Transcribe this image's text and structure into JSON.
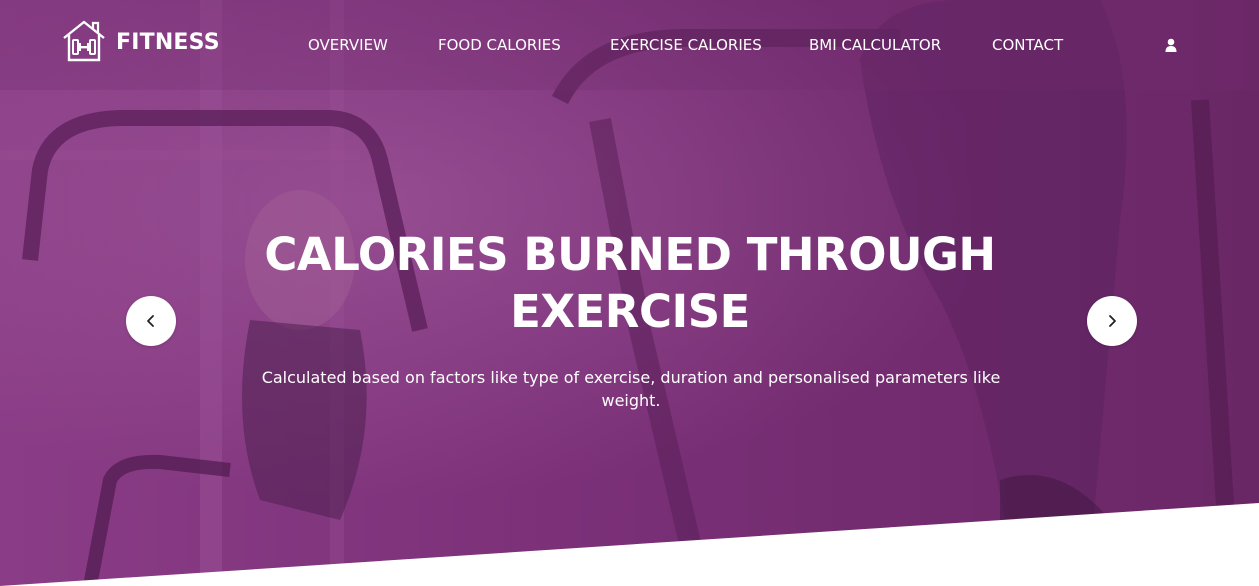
{
  "brand": {
    "name": "FITNESS",
    "logo_icon": "house-dumbbell-icon"
  },
  "nav": {
    "items": [
      {
        "label": "OVERVIEW"
      },
      {
        "label": "FOOD CALORIES"
      },
      {
        "label": "EXERCISE CALORIES"
      },
      {
        "label": "BMI CALCULATOR"
      },
      {
        "label": "CONTACT"
      }
    ],
    "account_icon": "user-icon"
  },
  "hero": {
    "title": "CALORIES BURNED THROUGH EXERCISE",
    "subtitle": "Calculated based on factors like type of exercise, duration and personalised parameters like weight.",
    "prev_icon": "chevron-left-icon",
    "next_icon": "chevron-right-icon"
  },
  "colors": {
    "overlay": "#7a2f76",
    "overlay_dark": "#5e2460",
    "text": "#ffffff",
    "page_bg": "#ffffff"
  }
}
